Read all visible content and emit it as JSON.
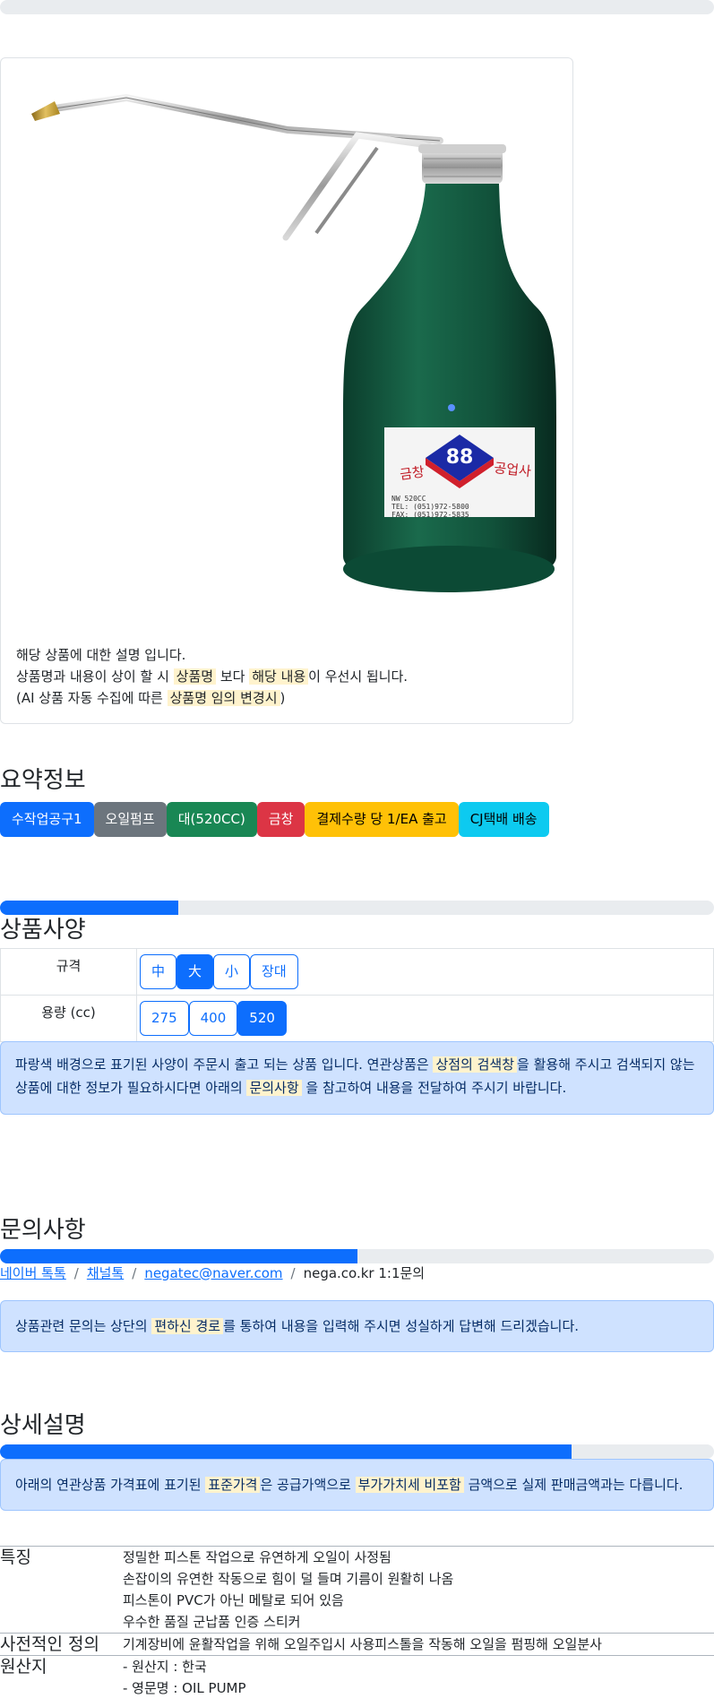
{
  "product": {
    "image_alt": "오일펌프",
    "label_brand": "금창",
    "label_company": "공업사",
    "label_number": "88",
    "label_line1": "NW 520CC",
    "label_line2": "TEL: (051)972-5800",
    "label_line3": "FAX: (051)972-5835",
    "desc_line1": "해당 상품에 대한 설명 입니다.",
    "desc_line2_a": "상품명과 내용이 상이 할 시 ",
    "desc_line2_hl1": "상품명",
    "desc_line2_b": " 보다 ",
    "desc_line2_hl2": "해당 내용",
    "desc_line2_c": "이 우선시 됩니다.",
    "desc_line3_a": "(AI 상품 자동 수집에 따른 ",
    "desc_line3_hl": "상품명 임의 변경시",
    "desc_line3_b": ")"
  },
  "summary": {
    "title": "요약정보",
    "badges": [
      {
        "label": "수작업공구1",
        "color": "#0d6efd"
      },
      {
        "label": "오일펌프",
        "color": "#6c757d"
      },
      {
        "label": "대(520CC)",
        "color": "#198754"
      },
      {
        "label": "금창",
        "color": "#dc3545"
      },
      {
        "label": "결제수량 당 1/EA 출고",
        "color": "#ffc107"
      },
      {
        "label": "CJ택배 배송",
        "color": "#0dcaf0"
      }
    ]
  },
  "spec": {
    "title": "상품사양",
    "progress": 0.25,
    "rows": [
      {
        "label": "규격",
        "options": [
          "中",
          "大",
          "小",
          "장대"
        ],
        "selected": 1
      },
      {
        "label": "용량 (cc)",
        "options": [
          "275",
          "400",
          "520"
        ],
        "selected": 2
      }
    ],
    "notice_a": "파랑색 배경으로 표기된 사양이 주문시 출고 되는 상품 입니다. 연관상품은 ",
    "notice_hl1": "상점의 검색창",
    "notice_b": "을 활용해 주시고 검색되지 않는 상품에 대한 정보가 필요하시다면 아래의 ",
    "notice_hl2": "문의사항",
    "notice_c": " 을 참고하여 내용을 전달하여 주시기 바랍니다."
  },
  "inquiry": {
    "title": "문의사항",
    "progress": 0.5,
    "links": [
      "네이버 톡톡",
      "채널톡",
      "negatec@naver.com"
    ],
    "plain": "nega.co.kr 1:1문의",
    "separator": "/",
    "notice_a": "상품관련 문의는 상단의 ",
    "notice_hl": "편하신 경로",
    "notice_b": "를 통하여 내용을 입력해 주시면 성실하게 답변해 드리겠습니다."
  },
  "detail": {
    "title": "상세설명",
    "progress": 0.8,
    "notice_a": "아래의 연관상품 가격표에 표기된 ",
    "notice_hl1": "표준가격",
    "notice_b": "은 공급가액으로 ",
    "notice_hl2": "부가가치세 비포함",
    "notice_c": " 금액으로 실제 판매금액과는 다릅니다.",
    "rows": [
      {
        "label": "특징",
        "values": [
          "정밀한 피스톤 작업으로 유연하게 오일이 사정됨",
          "손잡이의 유연한 작동으로 힘이 덜 들며 기름이 원활히 나옴",
          "피스톤이 PVC가 아닌 메탈로 되어 있음",
          "우수한 품질 군납품 인증 스티커"
        ]
      },
      {
        "label": "사전적인 정의",
        "values": [
          "기계장비에 윤활작업을 위해 오일주입시 사용피스톨을 작동해 오일을 펌핑해 오일분사"
        ]
      },
      {
        "label": "원산지",
        "values": [
          "- 원산지 : 한국",
          "- 영문명 : OIL PUMP"
        ]
      }
    ]
  }
}
